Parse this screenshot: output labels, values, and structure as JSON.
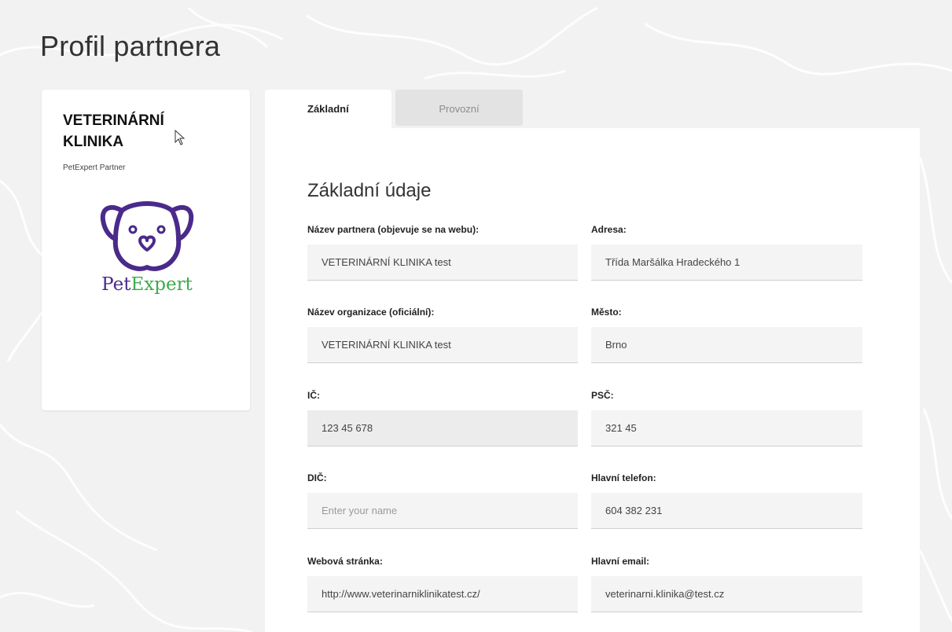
{
  "page": {
    "title": "Profil partnera"
  },
  "profile": {
    "name": "VETERINÁRNÍ KLINIKA",
    "subtitle": "PetExpert Partner",
    "logo": {
      "text_part1": "Pet",
      "text_part2": "Expert"
    }
  },
  "tabs": [
    {
      "label": "Základní",
      "active": true
    },
    {
      "label": "Provozní",
      "active": false
    }
  ],
  "form": {
    "section_title": "Základní údaje",
    "fields": {
      "partner_name": {
        "label": "Název partnera (objevuje se na webu):",
        "value": "VETERINÁRNÍ KLINIKA test"
      },
      "address": {
        "label": "Adresa:",
        "value": "Třída Maršálka Hradeckého 1"
      },
      "org_name": {
        "label": "Název organizace (oficiální):",
        "value": "VETERINÁRNÍ KLINIKA test"
      },
      "city": {
        "label": "Město:",
        "value": "Brno"
      },
      "ic": {
        "label": "IČ:",
        "value": "123 45 678"
      },
      "psc": {
        "label": "PSČ:",
        "value": "321 45"
      },
      "dic": {
        "label": "DIČ:",
        "value": "",
        "placeholder": "Enter your name"
      },
      "phone": {
        "label": "Hlavní telefon:",
        "value": "604 382 231"
      },
      "website": {
        "label": "Webová stránka:",
        "value": "http://www.veterinarniklinikatest.cz/"
      },
      "email": {
        "label": "Hlavní email:",
        "value": "veterinarni.klinika@test.cz"
      }
    }
  },
  "colors": {
    "brand_purple": "#4a2a8a",
    "brand_green": "#3dab4b",
    "page_background": "#f2f2f2",
    "tab_inactive": "#e3e3e3"
  }
}
